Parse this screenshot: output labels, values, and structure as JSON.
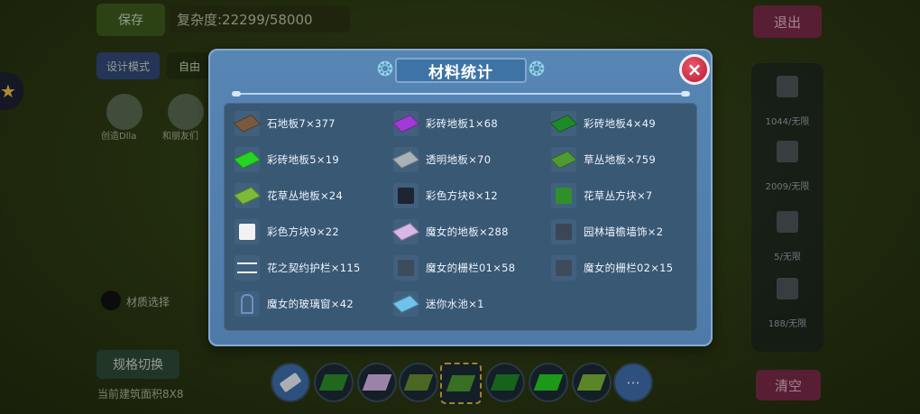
{
  "background": {
    "save_label": "保存",
    "complexity_label": "复杂度:22299/58000",
    "design_mode_label": "设计模式",
    "free_mode_label": "自由",
    "exit_label": "退出",
    "clear_label": "清空",
    "spec_switch_label": "规格切换",
    "note_text": "当前建筑面积8X8",
    "dot_label": "材质选择",
    "right_panel": [
      {
        "label": "1044/无限"
      },
      {
        "label": "2009/无限"
      },
      {
        "label": "5/无限"
      },
      {
        "label": "188/无限"
      }
    ],
    "avatar_labels": [
      "创造Dlla",
      "和朋友们"
    ]
  },
  "modal": {
    "title": "材料统计",
    "close_icon": "×",
    "materials": [
      {
        "label": "石地板7×377",
        "color": "#7a5a3e",
        "shape": "tile"
      },
      {
        "label": "彩砖地板1×68",
        "color": "#a23ad6",
        "shape": "tile"
      },
      {
        "label": "彩砖地板4×49",
        "color": "#1f8a2a",
        "shape": "tile"
      },
      {
        "label": "彩砖地板5×19",
        "color": "#27d423",
        "shape": "tile"
      },
      {
        "label": "透明地板×70",
        "color": "#a9b2b6",
        "shape": "tile"
      },
      {
        "label": "草丛地板×759",
        "color": "#4e9a33",
        "shape": "tile"
      },
      {
        "label": "花草丛地板×24",
        "color": "#7dba38",
        "shape": "tile"
      },
      {
        "label": "彩色方块8×12",
        "color": "#1f2433",
        "shape": "cube"
      },
      {
        "label": "花草丛方块×7",
        "color": "#2f8f2a",
        "shape": "cube"
      },
      {
        "label": "彩色方块9×22",
        "color": "#f2f2f2",
        "shape": "cube"
      },
      {
        "label": "魔女的地板×288",
        "color": "#d7b6e8",
        "shape": "tile"
      },
      {
        "label": "园林墙檐墙饰×2",
        "color": "#3b4656",
        "shape": "cube"
      },
      {
        "label": "花之契约护栏×115",
        "color": "#f0f0f0",
        "shape": "fence"
      },
      {
        "label": "魔女的栅栏01×58",
        "color": "#3d4c5c",
        "shape": "cube"
      },
      {
        "label": "魔女的栅栏02×15",
        "color": "#3d4c5c",
        "shape": "cube"
      },
      {
        "label": "魔女的玻璃窗×42",
        "color": "#6d8fc9",
        "shape": "window"
      },
      {
        "label": "迷你水池×1",
        "color": "#6fc2ec",
        "shape": "tile"
      }
    ]
  },
  "hotbar": {
    "more_label": "···"
  }
}
